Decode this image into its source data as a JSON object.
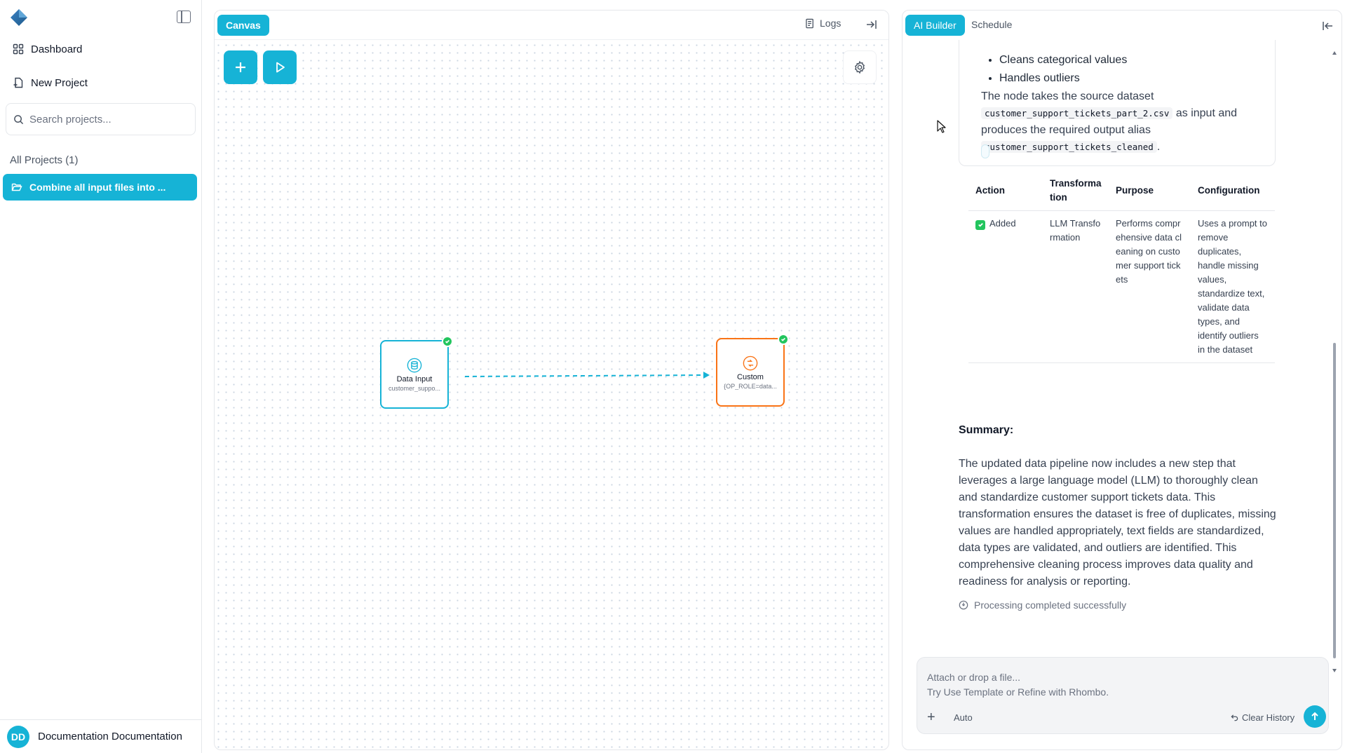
{
  "sidebar": {
    "nav": {
      "dashboard": "Dashboard",
      "new_project": "New Project"
    },
    "search_placeholder": "Search projects...",
    "all_projects_label": "All Projects (1)",
    "projects": [
      {
        "name": "Combine all input files into ..."
      }
    ],
    "user": {
      "initials": "DD",
      "name": "Documentation Documentation"
    }
  },
  "canvas": {
    "tab_label": "Canvas",
    "logs_label": "Logs",
    "nodes": [
      {
        "title": "Data Input",
        "subtitle": "customer_suppo..."
      },
      {
        "title": "Custom",
        "subtitle": "{OP_ROLE=data..."
      }
    ]
  },
  "right_panel": {
    "tabs": {
      "ai_builder": "AI Builder",
      "schedule": "Schedule"
    },
    "message": {
      "bullets": [
        "Cleans categorical values",
        "Handles outliers"
      ],
      "para_1": "The node takes the source dataset ",
      "code_source": "customer_support_tickets_part_2.csv",
      "para_2": " as input and produces the required output alias ",
      "code_alias": "customer_support_tickets_cleaned",
      "para_3": ".",
      "table": {
        "headers": [
          "Action",
          "Transformation",
          "Purpose",
          "Configuration"
        ],
        "rows": [
          {
            "action": "Added",
            "transformation": "LLM Transformation",
            "purpose": "Performs comprehensive data cleaning on customer support tickets",
            "configuration": "Uses a prompt to remove duplicates, handle missing values, standardize text, validate data types, and identify outliers in the dataset"
          }
        ]
      },
      "summary_title": "Summary:",
      "summary_text": "The updated data pipeline now includes a new step that leverages a large language model (LLM) to thoroughly clean and standardize customer support tickets data. This transformation ensures the dataset is free of duplicates, missing values are handled appropriately, text fields are standardized, data types are validated, and outliers are identified. This comprehensive cleaning process improves data quality and readiness for analysis or reporting.",
      "status": "Processing completed successfully"
    },
    "composer": {
      "placeholder_line1": "Attach or drop a file...",
      "placeholder_line2": "Try Use Template or Refine with Rhombo.",
      "mode": "Auto",
      "clear_history": "Clear History"
    }
  },
  "colors": {
    "accent": "#16b3d6",
    "success": "#22c55e",
    "custom_node": "#f97316"
  }
}
